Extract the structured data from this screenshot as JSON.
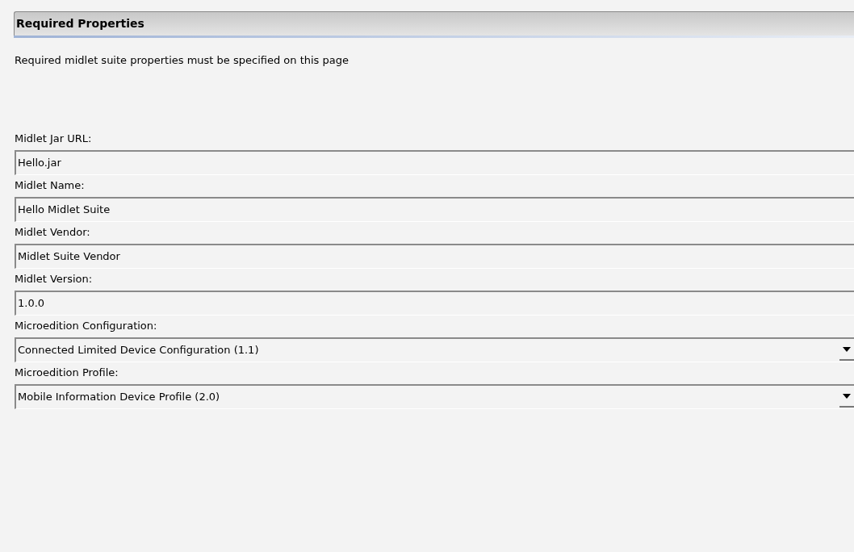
{
  "section": {
    "title": "Required Properties",
    "description": "Required midlet suite properties must be specified on this page"
  },
  "fields": [
    {
      "kind": "text",
      "label": "Midlet Jar URL:",
      "value": "Hello.jar"
    },
    {
      "kind": "text",
      "label": "Midlet Name:",
      "value": "Hello Midlet Suite"
    },
    {
      "kind": "text",
      "label": "Midlet Vendor:",
      "value": "Midlet Suite Vendor"
    },
    {
      "kind": "text",
      "label": "Midlet Version:",
      "value": "1.0.0"
    },
    {
      "kind": "dropdown",
      "label": "Microedition Configuration:",
      "value": "Connected Limited Device Configuration (1.1)"
    },
    {
      "kind": "dropdown",
      "label": "Microedition Profile:",
      "value": "Mobile Information Device Profile (2.0)"
    }
  ]
}
